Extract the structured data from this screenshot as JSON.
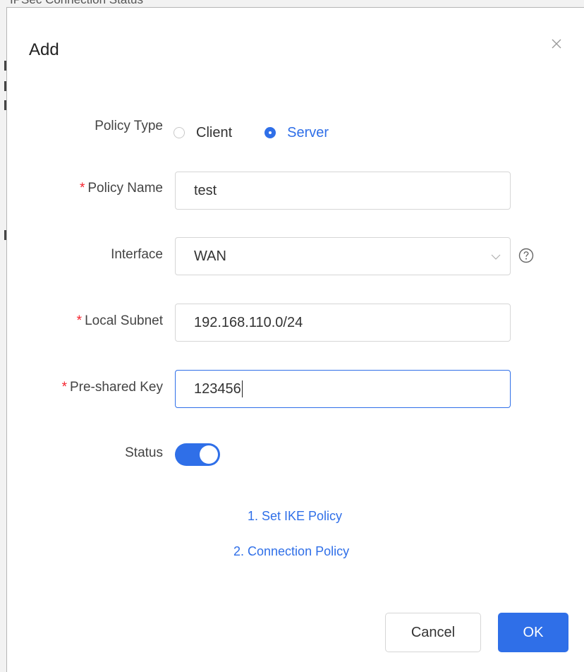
{
  "background": {
    "title": "IPSec Connection Status"
  },
  "dialog": {
    "title": "Add",
    "close_icon": "close-icon"
  },
  "form": {
    "policy_type": {
      "label": "Policy Type",
      "options": [
        {
          "label": "Client",
          "checked": false
        },
        {
          "label": "Server",
          "checked": true
        }
      ]
    },
    "policy_name": {
      "label": "Policy Name",
      "required": "*",
      "value": "test"
    },
    "interface": {
      "label": "Interface",
      "value": "WAN",
      "help_icon": "question-circle-icon",
      "dropdown_icon": "chevron-down-icon"
    },
    "local_subnet": {
      "label": "Local Subnet",
      "required": "*",
      "value": "192.168.110.0/24"
    },
    "pre_shared_key": {
      "label": "Pre-shared Key",
      "required": "*",
      "value": "123456"
    },
    "status": {
      "label": "Status",
      "enabled": true
    }
  },
  "links": {
    "set_ike": "1. Set IKE Policy",
    "connection_policy": "2. Connection Policy"
  },
  "footer": {
    "cancel_label": "Cancel",
    "ok_label": "OK"
  },
  "colors": {
    "primary": "#2f6fe8",
    "required": "#f5222d",
    "border": "#d6d6d6"
  }
}
